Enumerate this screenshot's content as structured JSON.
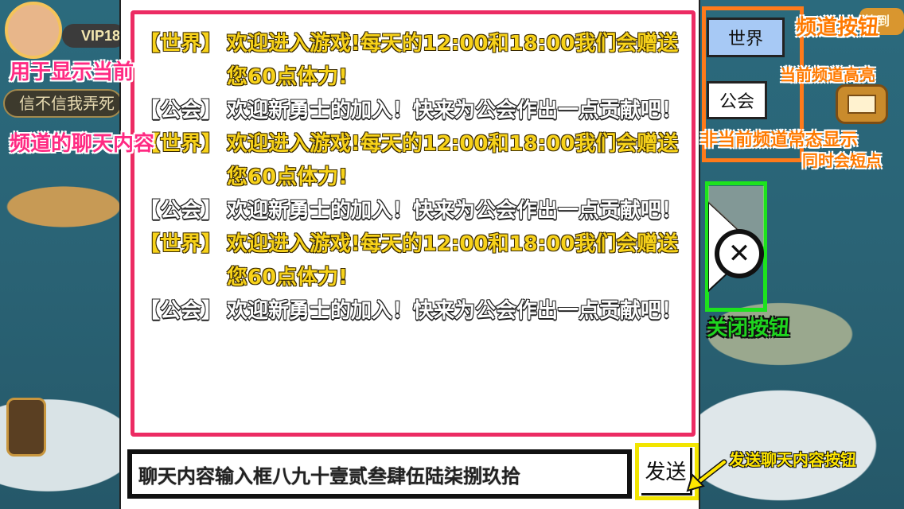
{
  "background": {
    "vip_label": "VIP18",
    "left_pill_text": "信不信我弄死",
    "right_sign_label": "签到"
  },
  "messages": [
    {
      "channel": "world",
      "tag": "【世界】",
      "text": "欢迎进入游戏!每天的12:00和18:00我们会赠送您60点体力!"
    },
    {
      "channel": "guild",
      "tag": "【公会】",
      "text": "欢迎新勇士的加入！快来为公会作出一点贡献吧！"
    },
    {
      "channel": "world",
      "tag": "【世界】",
      "text": "欢迎进入游戏!每天的12:00和18:00我们会赠送您60点体力!"
    },
    {
      "channel": "guild",
      "tag": "【公会】",
      "text": "欢迎新勇士的加入！快来为公会作出一点贡献吧！"
    },
    {
      "channel": "world",
      "tag": "【世界】",
      "text": "欢迎进入游戏!每天的12:00和18:00我们会赠送您60点体力!"
    },
    {
      "channel": "guild",
      "tag": "【公会】",
      "text": "欢迎新勇士的加入！快来为公会作出一点贡献吧！"
    }
  ],
  "input": {
    "value": "聊天内容输入框八九十壹贰叁肆伍陆柒捌玖拾"
  },
  "send_button": {
    "label": "发送"
  },
  "channels": {
    "active_label": "世界",
    "inactive_label": "公会"
  },
  "close_button": {
    "glyph": "✕"
  },
  "annotations": {
    "display_area_line1": "用于显示当前",
    "display_area_line2": "频道的聊天内容",
    "channel_buttons": "频道按钮",
    "active_highlight": "当前频道高亮",
    "inactive_normal": "非当前频道常态显示",
    "inactive_short": "同时会短点",
    "close_button": "关闭按钮",
    "send_button": "发送聊天内容按钮"
  },
  "colors": {
    "message_border": "#ec2b63",
    "world_text": "#f7d21a",
    "channel_region_border": "#ff7a1a",
    "close_region_border": "#1de31d",
    "send_border": "#f2e500",
    "active_channel_bg": "#a7c9f5"
  }
}
